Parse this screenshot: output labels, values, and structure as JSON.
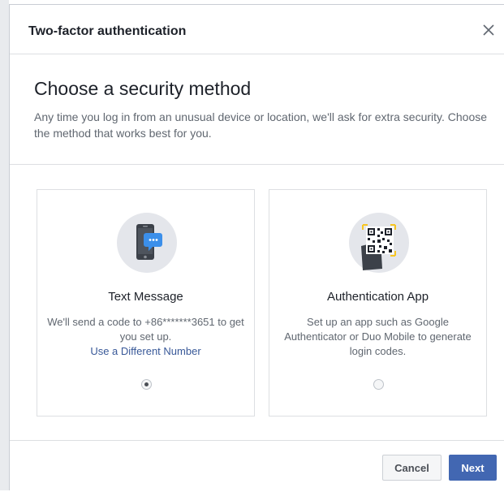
{
  "dialog": {
    "title": "Two-factor authentication",
    "close_icon": "close-icon"
  },
  "intro": {
    "heading": "Choose a security method",
    "description": "Any time you log in from an unusual device or location, we'll ask for extra security. Choose the method that works best for you."
  },
  "methods": [
    {
      "title": "Text Message",
      "description": "We'll send a code to +86*******3651 to get you set up.",
      "link": "Use a Different Number",
      "icon": "phone-chat-icon",
      "selected": true
    },
    {
      "title": "Authentication App",
      "description": "Set up an app such as Google Authenticator or Duo Mobile to generate login codes.",
      "icon": "qr-code-phone-icon",
      "selected": false
    }
  ],
  "footer": {
    "cancel_label": "Cancel",
    "next_label": "Next"
  },
  "colors": {
    "accent": "#4267b2",
    "link": "#385898",
    "icon_circle": "#e4e6eb",
    "chat_bubble": "#3b8fea"
  }
}
